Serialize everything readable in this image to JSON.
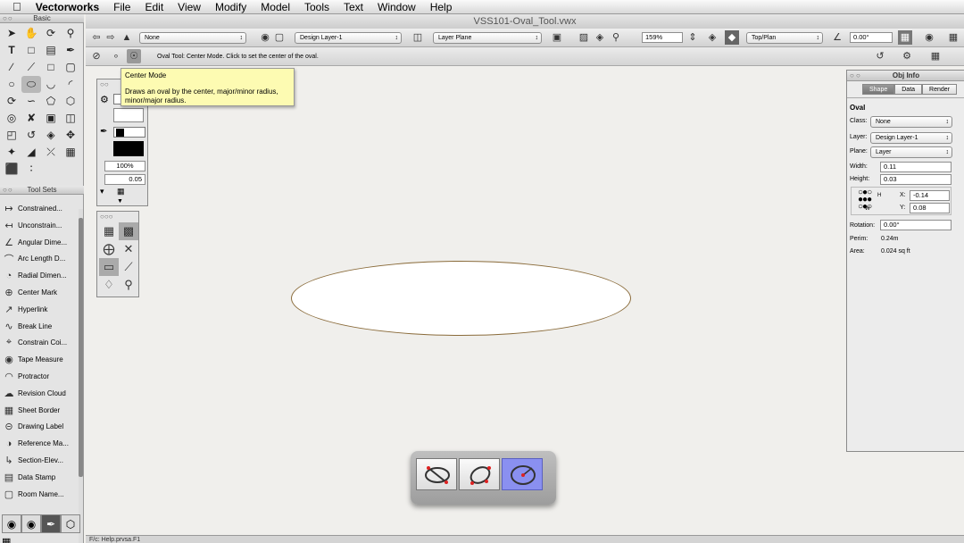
{
  "menubar": {
    "app": "Vectorworks",
    "items": [
      "File",
      "Edit",
      "View",
      "Modify",
      "Model",
      "Tools",
      "Text",
      "Window",
      "Help"
    ]
  },
  "window": {
    "title": "VSS101-Oval_Tool.vwx"
  },
  "view_bar": {
    "class": "None",
    "layer": "Design Layer-1",
    "plane": "Layer Plane",
    "zoom": "159%",
    "view": "Top/Plan",
    "rotation": "0.00°"
  },
  "mode_bar": {
    "hint": "Oval Tool: Center Mode. Click to set the center of the oval."
  },
  "tooltip": {
    "title": "Center Mode",
    "text": "Draws an oval by the center, major/minor radius, minor/major radius."
  },
  "basic_palette": {
    "title": "Basic"
  },
  "tool_sets": {
    "title": "Tool Sets",
    "items": [
      {
        "label": "Constrained...",
        "icon": "constrained-dim-icon"
      },
      {
        "label": "Unconstrain...",
        "icon": "unconstrained-dim-icon"
      },
      {
        "label": "Angular Dime...",
        "icon": "angular-dim-icon"
      },
      {
        "label": "Arc Length D...",
        "icon": "arc-length-icon"
      },
      {
        "label": "Radial Dimen...",
        "icon": "radial-dim-icon"
      },
      {
        "label": "Center Mark",
        "icon": "center-mark-icon"
      },
      {
        "label": "Hyperlink",
        "icon": "hyperlink-icon"
      },
      {
        "label": "Break Line",
        "icon": "break-line-icon"
      },
      {
        "label": "Constrain Coi...",
        "icon": "constrain-icon"
      },
      {
        "label": "Tape Measure",
        "icon": "tape-measure-icon"
      },
      {
        "label": "Protractor",
        "icon": "protractor-icon"
      },
      {
        "label": "Revision Cloud",
        "icon": "revision-cloud-icon"
      },
      {
        "label": "Sheet Border",
        "icon": "sheet-border-icon"
      },
      {
        "label": "Drawing Label",
        "icon": "drawing-label-icon"
      },
      {
        "label": "Reference Ma...",
        "icon": "reference-marker-icon"
      },
      {
        "label": "Section-Elev...",
        "icon": "section-elevation-icon"
      },
      {
        "label": "Data Stamp",
        "icon": "data-stamp-icon"
      },
      {
        "label": "Room Name...",
        "icon": "room-name-icon"
      }
    ]
  },
  "attributes": {
    "opacity": "100%",
    "line_weight": "0.05"
  },
  "obj_info": {
    "title": "Obj Info",
    "tabs": [
      "Shape",
      "Data",
      "Render"
    ],
    "object": "Oval",
    "class_label": "Class:",
    "class": "None",
    "layer_label": "Layer:",
    "layer": "Design Layer-1",
    "plane_label": "Plane:",
    "plane": "Layer",
    "width_label": "Width:",
    "width": "0.11",
    "height_label": "Height:",
    "height": "0.03",
    "x_label": "X:",
    "x": "-0.14",
    "y_label": "Y:",
    "y": "0.08",
    "rotation_label": "Rotation:",
    "rotation": "0.00°",
    "perim_label": "Perim:",
    "perim": "0.24m",
    "area_label": "Area:",
    "area": "0.024 sq ft",
    "h": "H",
    "w": "W"
  },
  "status": {
    "text": "F/c: Help.prvsa.F1"
  }
}
